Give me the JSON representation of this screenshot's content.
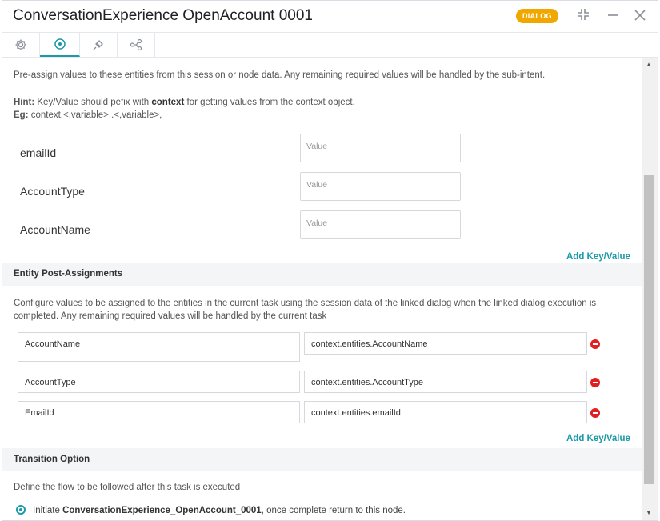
{
  "header": {
    "title": "ConversationExperience OpenAccount 0001",
    "badge": "DIALOG"
  },
  "tabs": [
    {
      "icon": "gear-icon"
    },
    {
      "icon": "target-icon",
      "active": true
    },
    {
      "icon": "plug-icon"
    },
    {
      "icon": "connections-icon"
    }
  ],
  "pre_assign": {
    "description": "Pre-assign values to these entities from this session or node data. Any remaining required values will be handled by the sub-intent.",
    "hint_label": "Hint:",
    "hint_text_1": " Key/Value should pefix with ",
    "hint_keyword": "context",
    "hint_text_2": " for getting values from the context object.",
    "eg_label": "Eg:",
    "eg_text": " context.<,variable>,.<,variable>,",
    "entities": [
      {
        "label": "emailId",
        "placeholder": "Value"
      },
      {
        "label": "AccountType",
        "placeholder": "Value"
      },
      {
        "label": "AccountName",
        "placeholder": "Value"
      }
    ],
    "add_link": "Add Key/Value"
  },
  "post_assign": {
    "title": "Entity Post-Assignments",
    "description": "Configure values to be assigned to the entities in the current task using the session data of the linked dialog when the linked dialog execution is completed. Any remaining required values will be handled by the current task",
    "rows": [
      {
        "key": "AccountName",
        "value": "context.entities.AccountName"
      },
      {
        "key": "AccountType",
        "value": "context.entities.AccountType"
      },
      {
        "key": "EmailId",
        "value": "context.entities.emailId"
      }
    ],
    "add_link": "Add Key/Value"
  },
  "transition": {
    "title": "Transition Option",
    "description": "Define the flow to be followed after this task is executed",
    "option_prefix": "Initiate ",
    "option_bold": "ConversationExperience_OpenAccount_0001",
    "option_suffix": ", once complete return to this node."
  },
  "colors": {
    "accent": "#1b9aa8",
    "badge": "#f0a800",
    "remove": "#e02020"
  }
}
